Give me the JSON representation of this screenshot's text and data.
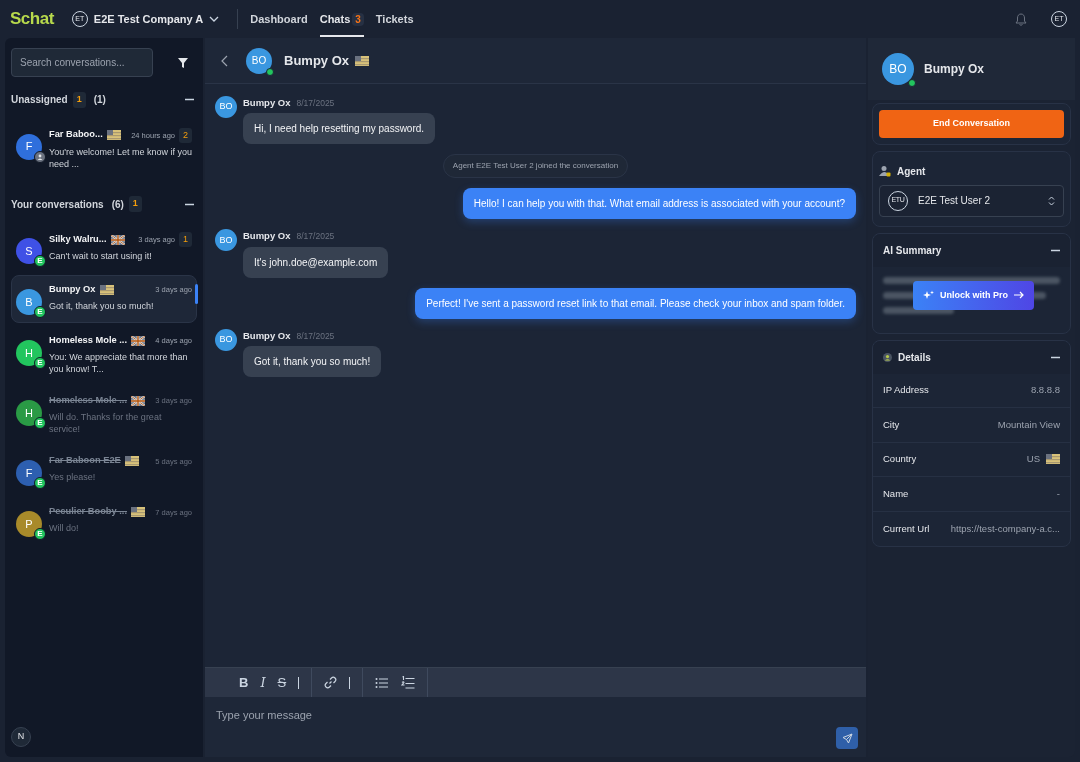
{
  "topbar": {
    "logo": "Schat",
    "company": {
      "initials": "ET",
      "name": "E2E Test Company A"
    },
    "nav": [
      {
        "label": "Dashboard",
        "selected": false
      },
      {
        "label": "Chats",
        "selected": true,
        "count": "3"
      },
      {
        "label": "Tickets",
        "selected": false
      }
    ],
    "user_initials": "ET"
  },
  "sidebar": {
    "search": {
      "placeholder": "Search conversations..."
    },
    "sections": [
      {
        "title": "Unassigned",
        "badge": "1",
        "count": "(1)",
        "expanded": true,
        "conversations": [
          {
            "initial": "F",
            "color": "#2f6fdc",
            "name": "Far Baboo...",
            "flag": {
              "kind": "us"
            },
            "time": "24 hours ago",
            "unread": "2",
            "preview": "You're welcome! Let me know if you need ...",
            "selected": false,
            "closed": false
          }
        ]
      },
      {
        "title": "Your conversations",
        "count": "(6)",
        "badge": "1",
        "expanded": true,
        "conversations": [
          {
            "initial": "S",
            "color": "#3f51e6",
            "status": "E",
            "name": "Silky Walru...",
            "flag": {
              "kind": "gb"
            },
            "time": "3 days ago",
            "unread": "1",
            "preview": "Can't wait to start using it!",
            "selected": false,
            "closed": false
          },
          {
            "initial": "B",
            "color": "#3a97e0",
            "status": "E",
            "name": "Bumpy Ox",
            "flag": {
              "kind": "us"
            },
            "time": "3 days ago",
            "preview": "Got it, thank you so much!",
            "selected": true,
            "closed": false
          },
          {
            "initial": "H",
            "color": "#22c55e",
            "status": "E",
            "name": "Homeless Mole ...",
            "flag": {
              "kind": "gb"
            },
            "time": "4 days ago",
            "preview": "You: We appreciate that more than you know! T...",
            "selected": false,
            "closed": false
          },
          {
            "initial": "H",
            "color": "#2a9a45",
            "status": "E",
            "name": "Homeless Mole ...",
            "flag": {
              "kind": "gb"
            },
            "time": "3 days ago",
            "preview": "Will do. Thanks for the great service!",
            "selected": false,
            "closed": true
          },
          {
            "initial": "F",
            "color": "#2d5fb0",
            "status": "E",
            "name": "Far Baboon E2E",
            "flag": {
              "kind": "us"
            },
            "time": "5 days ago",
            "preview": "Yes please!",
            "selected": false,
            "closed": true
          },
          {
            "initial": "P",
            "color": "#a88a2a",
            "status": "E",
            "name": "Peculier Booby ...",
            "flag": {
              "kind": "us"
            },
            "time": "7 days ago",
            "preview": "Will do!",
            "selected": false,
            "closed": true
          }
        ]
      }
    ],
    "footer_initial": "N"
  },
  "chat": {
    "header": {
      "initials": "BO",
      "name": "Bumpy Ox",
      "flag": {
        "kind": "us"
      },
      "online": true
    },
    "messages": [
      {
        "kind": "customer",
        "initials": "BO",
        "sender": "Bumpy Ox",
        "date": "8/17/2025",
        "text": "Hi, I need help resetting my password."
      },
      {
        "kind": "system",
        "text": "Agent E2E Test User 2 joined the conversation"
      },
      {
        "kind": "agent",
        "text": "Hello! I can help you with that. What email address is associated with your account?"
      },
      {
        "kind": "customer",
        "initials": "BO",
        "sender": "Bumpy Ox",
        "date": "8/17/2025",
        "text": "It's john.doe@example.com"
      },
      {
        "kind": "agent",
        "text": "Perfect! I've sent a password reset link to that email. Please check your inbox and spam folder."
      },
      {
        "kind": "customer",
        "initials": "BO",
        "sender": "Bumpy Ox",
        "date": "8/17/2025",
        "text": "Got it, thank you so much!"
      }
    ],
    "toolbar": [
      {
        "kind": "bold",
        "label": "B"
      },
      {
        "kind": "italic",
        "label": "I"
      },
      {
        "kind": "strike",
        "label": "S"
      },
      {
        "kind": "link"
      },
      {
        "kind": "bullets"
      },
      {
        "kind": "numbers"
      }
    ],
    "composer": {
      "placeholder": "Type your message"
    }
  },
  "details_panel": {
    "initials": "BO",
    "name": "Bumpy Ox",
    "online": true,
    "end_button": "End Conversation",
    "agent": {
      "title": "Agent",
      "initials": "ETU",
      "value": "E2E Test User 2"
    },
    "ai_summary": {
      "title": "AI Summary",
      "expanded": true,
      "unlock_button": "Unlock with Pro"
    },
    "details": {
      "title": "Details",
      "expanded": true,
      "rows": [
        {
          "label": "IP Address",
          "value": "8.8.8.8"
        },
        {
          "label": "City",
          "value": "Mountain View"
        },
        {
          "label": "Country",
          "value": "US",
          "flag": {
            "kind": "us"
          }
        },
        {
          "label": "Name",
          "value": "-"
        },
        {
          "label": "Current Url",
          "value": "https://test-company-a.c..."
        }
      ]
    }
  }
}
